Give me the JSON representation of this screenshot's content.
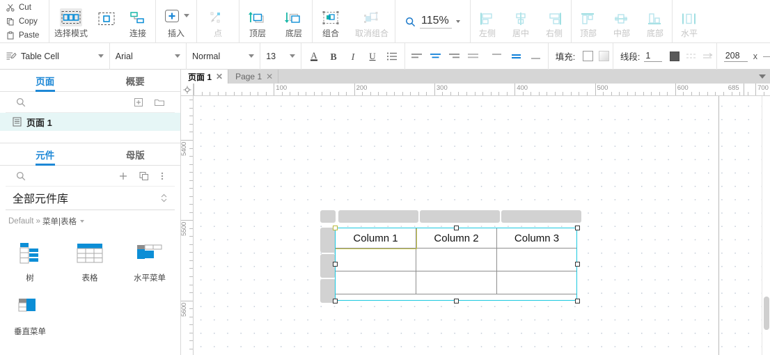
{
  "toolbar_main": {
    "clipboard": [
      {
        "label": "Cut",
        "icon": "scissors-icon"
      },
      {
        "label": "Copy",
        "icon": "copy-icon"
      },
      {
        "label": "Paste",
        "icon": "paste-icon"
      }
    ],
    "buttons": [
      {
        "label": "选择模式",
        "icon": "select-mode-icon",
        "active": true,
        "disabled": false
      },
      {
        "label": "连接",
        "icon": "connect-icon",
        "active": false,
        "disabled": false
      },
      {
        "label": "插入",
        "icon": "insert-plus-icon",
        "active": false,
        "disabled": false,
        "has_caret": true
      },
      {
        "label": "点",
        "icon": "point-icon",
        "active": false,
        "disabled": true
      },
      {
        "label": "顶层",
        "icon": "bring-to-front-icon",
        "active": false,
        "disabled": false
      },
      {
        "label": "底层",
        "icon": "send-to-back-icon",
        "active": false,
        "disabled": false
      },
      {
        "label": "组合",
        "icon": "group-icon",
        "active": false,
        "disabled": false
      },
      {
        "label": "取消组合",
        "icon": "ungroup-icon",
        "active": false,
        "disabled": true
      },
      {
        "label": "左侧",
        "icon": "align-left-icon",
        "active": false,
        "disabled": true
      },
      {
        "label": "居中",
        "icon": "align-center-icon",
        "active": false,
        "disabled": true
      },
      {
        "label": "右侧",
        "icon": "align-right-icon",
        "active": false,
        "disabled": true
      },
      {
        "label": "顶部",
        "icon": "align-top-icon",
        "active": false,
        "disabled": true
      },
      {
        "label": "中部",
        "icon": "align-middle-icon",
        "active": false,
        "disabled": true
      },
      {
        "label": "底部",
        "icon": "align-bottom-icon",
        "active": false,
        "disabled": true
      },
      {
        "label": "水平",
        "icon": "distribute-horizontal-icon",
        "active": false,
        "disabled": true
      }
    ],
    "zoom": {
      "value": "115%",
      "icon": "magnifier-icon"
    }
  },
  "toolbar_format": {
    "style_combo": {
      "value": "Table Cell",
      "icon": "style-icon"
    },
    "font_combo": {
      "value": "Arial"
    },
    "weight_combo": {
      "value": "Normal"
    },
    "size_combo": {
      "value": "13"
    },
    "text_icons": [
      {
        "name": "font-color-icon",
        "label": "A"
      },
      {
        "name": "bold-icon",
        "label": "B"
      },
      {
        "name": "italic-icon",
        "label": "I"
      },
      {
        "name": "underline-icon",
        "label": "U"
      },
      {
        "name": "bullet-list-icon",
        "label": "≔"
      }
    ],
    "align_icons": [
      {
        "name": "text-align-left-icon",
        "active": false
      },
      {
        "name": "text-align-center-icon",
        "active": true
      },
      {
        "name": "text-align-right-icon",
        "active": false
      },
      {
        "name": "text-align-justify-icon",
        "active": false
      }
    ],
    "valign_icons": [
      {
        "name": "valign-top-icon",
        "active": false
      },
      {
        "name": "valign-middle-icon",
        "active": true
      },
      {
        "name": "valign-bottom-icon",
        "active": false
      }
    ],
    "fill_label": "填充:",
    "line_label": "线段:",
    "line_width": "1",
    "x_value": "208",
    "x_label": "x"
  },
  "sidebar": {
    "pages_tabs": [
      {
        "label": "页面",
        "active": true
      },
      {
        "label": "概要",
        "active": false
      }
    ],
    "pages_toolbar": [
      {
        "name": "search-icon"
      },
      {
        "name": "add-page-icon"
      },
      {
        "name": "new-folder-icon"
      }
    ],
    "pages": [
      {
        "label": "页面 1",
        "icon": "page-icon",
        "selected": true
      }
    ],
    "widgets_tabs": [
      {
        "label": "元件",
        "active": true
      },
      {
        "label": "母版",
        "active": false
      }
    ],
    "widgets_toolbar": [
      {
        "name": "search-icon"
      },
      {
        "name": "add-library-icon"
      },
      {
        "name": "duplicate-icon"
      },
      {
        "name": "more-options-icon"
      }
    ],
    "library_name": "全部元件库",
    "library_path_prefix": "Default »",
    "library_path_group": "菜单|表格",
    "widgets": [
      {
        "label": "树",
        "icon": "tree-widget-icon"
      },
      {
        "label": "表格",
        "icon": "table-widget-icon"
      },
      {
        "label": "水平菜单",
        "icon": "horizontal-menu-widget-icon"
      },
      {
        "label": "垂直菜单",
        "icon": "vertical-menu-widget-icon"
      }
    ]
  },
  "canvas": {
    "tabs": [
      {
        "label": "页面 1",
        "active": true,
        "close": "✕"
      },
      {
        "label": "Page 1",
        "active": false,
        "close": "✕"
      }
    ],
    "tab_menu_icon": "chevron-down-icon",
    "h_ruler_labels": [
      "100",
      "200",
      "300",
      "400",
      "500",
      "600",
      "700"
    ],
    "h_guide_label": "685",
    "v_ruler_labels": [
      "5400",
      "5500",
      "5600"
    ],
    "table": {
      "headers": [
        "Column 1",
        "Column 2",
        "Column 3"
      ],
      "rows": [
        [
          "",
          "",
          ""
        ],
        [
          "",
          "",
          ""
        ]
      ],
      "selected_cell": "Column 1"
    }
  },
  "colors": {
    "accent": "#1e88d6",
    "selection": "#19c8e0",
    "cell_selection": "#c9c94a",
    "widget_blue": "#0c8ed6",
    "page_row_bg": "#e6f6f6"
  }
}
